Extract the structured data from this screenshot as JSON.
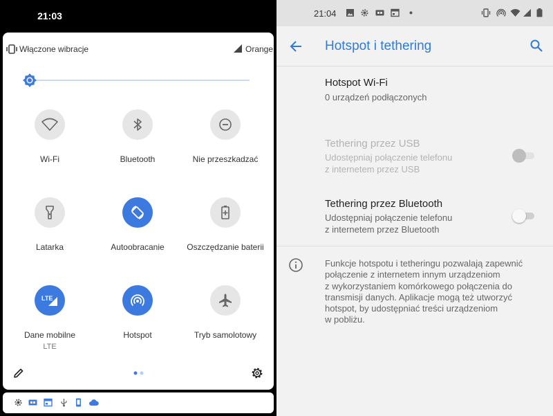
{
  "left": {
    "status_time": "21:03",
    "vibration_label": "Włączone wibracje",
    "carrier": "Orange",
    "brightness_level": 0.02,
    "tiles": [
      {
        "label": "Wi-Fi",
        "icon": "wifi-icon",
        "active": false
      },
      {
        "label": "Bluetooth",
        "icon": "bluetooth-icon",
        "active": false
      },
      {
        "label": "Nie przeszkadzać",
        "icon": "do-not-disturb-icon",
        "active": false
      },
      {
        "label": "Latarka",
        "icon": "flashlight-icon",
        "active": false
      },
      {
        "label": "Autoobracanie",
        "icon": "auto-rotate-icon",
        "active": true
      },
      {
        "label": "Oszczędzanie baterii",
        "icon": "battery-saver-icon",
        "active": false
      },
      {
        "label": "Dane mobilne",
        "sublabel": "LTE",
        "icon": "mobile-data-icon",
        "active": true
      },
      {
        "label": "Hotspot",
        "icon": "hotspot-icon",
        "active": true
      },
      {
        "label": "Tryb samolotowy",
        "icon": "airplane-icon",
        "active": false
      }
    ],
    "accent_color": "#3d7ae0"
  },
  "right": {
    "status_time": "21:04",
    "title": "Hotspot i tethering",
    "hotspot": {
      "title": "Hotspot Wi-Fi",
      "subtitle": "0 urządzeń podłączonych"
    },
    "usb": {
      "title": "Tethering przez USB",
      "subtitle_line1": "Udostępniaj połączenie telefonu",
      "subtitle_line2": "z internetem przez USB",
      "enabled": false,
      "on": false
    },
    "bluetooth": {
      "title": "Tethering przez Bluetooth",
      "subtitle_line1": "Udostępniaj połączenie telefonu",
      "subtitle_line2": "z internetem przez Bluetooth",
      "enabled": true,
      "on": false
    },
    "info_lines": [
      "Funkcje hotspotu i tetheringu pozwalają zapewnić",
      "połączenie z internetem innym urządzeniom",
      "z wykorzystaniem komórkowego połączenia do",
      "transmisji danych. Aplikacje mogą też utworzyć",
      "hotspot, by udostępniać treści urządzeniom",
      "w pobliżu."
    ],
    "accent_color": "#2f7bd6"
  }
}
